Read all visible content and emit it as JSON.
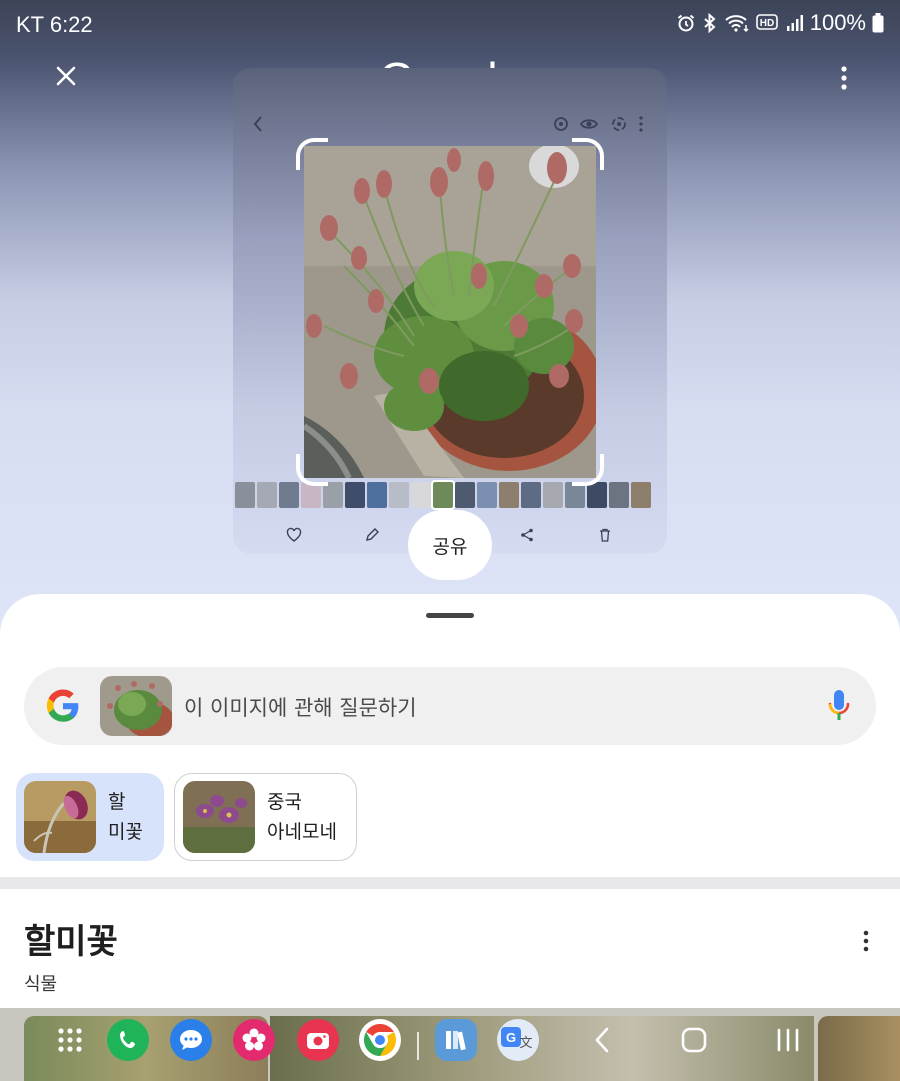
{
  "status_bar": {
    "carrier_time": "KT 6:22",
    "battery": "100%",
    "icons": [
      "alarm-icon",
      "bluetooth-icon",
      "wifi-icon",
      "hd-icon",
      "signal-icon",
      "battery-icon"
    ]
  },
  "header": {
    "logo": "Google",
    "close_icon": "close-icon",
    "more_icon": "more-vert-icon"
  },
  "preview": {
    "share_label": "공유",
    "action_icons": [
      "heart-icon",
      "edit-icon",
      "share-icon",
      "trash-icon"
    ]
  },
  "search": {
    "placeholder": "이 이미지에 관해 질문하기",
    "mic_icon": "mic-icon"
  },
  "chips": [
    {
      "label": "할\n미꽃",
      "selected": true
    },
    {
      "label": "중국\n아네모네",
      "selected": false
    }
  ],
  "result": {
    "title": "할미꽃",
    "subtitle": "식물"
  },
  "taskbar": {
    "apps": [
      "apps-grid-icon",
      "phone-app-icon",
      "messages-app-icon",
      "gallery-app-icon",
      "camera-app-icon",
      "chrome-app-icon",
      "books-app-icon",
      "translate-app-icon"
    ],
    "nav": [
      "back-nav-icon",
      "home-nav-icon",
      "recents-nav-icon"
    ]
  },
  "colors": {
    "accent_chip": "#d7e2fb",
    "search_bg": "#f0f0f0"
  }
}
